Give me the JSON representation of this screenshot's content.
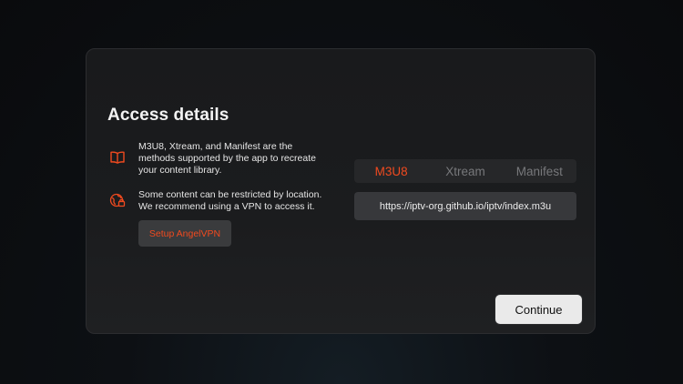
{
  "dialog": {
    "title": "Access details",
    "methods_info": "M3U8, Xtream, and Manifest are the\nmethods supported by the app to recreate\nyour content library.",
    "location_info": "Some content can be restricted by location.\nWe recommend using a VPN to access it.",
    "vpn_button_label": "Setup AngelVPN",
    "tabs": [
      {
        "label": "M3U8",
        "active": true
      },
      {
        "label": "Xtream",
        "active": false
      },
      {
        "label": "Manifest",
        "active": false
      }
    ],
    "url_value": "https://iptv-org.github.io/iptv/index.m3u",
    "continue_label": "Continue"
  },
  "icons": {
    "methods": "book-icon",
    "location": "globe-lock-icon"
  },
  "colors": {
    "accent": "#f04a1f",
    "panel_bg": "#1b1c1e",
    "button_bg": "#3a3b3d",
    "primary_button_bg": "#eaeaea"
  }
}
